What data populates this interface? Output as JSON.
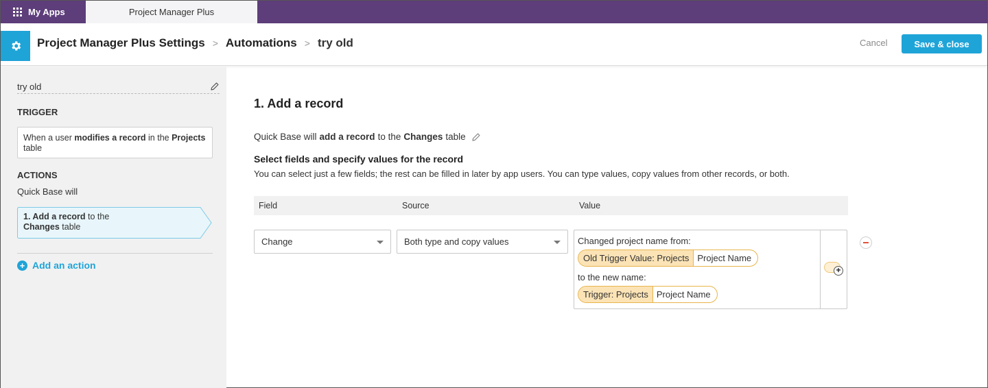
{
  "topbar": {
    "my_apps_label": "My Apps",
    "app_tab_label": "Project Manager Plus",
    "bg_color": "#5d3d7a"
  },
  "header": {
    "breadcrumb": [
      "Project Manager Plus Settings",
      "Automations",
      "try old"
    ],
    "cancel_label": "Cancel",
    "save_label": "Save & close",
    "accent_color": "#1fa4d8"
  },
  "sidebar": {
    "automation_name": "try old",
    "trigger_heading": "TRIGGER",
    "trigger": {
      "t1": "When a user ",
      "b1": "modifies a record",
      "t2": " in the ",
      "b2": "Projects",
      "t3": " table"
    },
    "actions_heading": "ACTIONS",
    "actions_intro": "Quick Base will",
    "action": {
      "b1": "1. Add a record",
      "t1": " to the",
      "b2": "Changes",
      "t2": " table"
    },
    "add_action_label": "Add an action"
  },
  "main": {
    "title": "1. Add a record",
    "desc": {
      "t1": "Quick Base will",
      "b1": "add a record",
      "t2": "to the",
      "b2": "Changes",
      "t3": "table"
    },
    "sub_heading": "Select fields and specify values for the record",
    "sub_text": "You can select just a few fields; the rest can be filled in later by app users. You can type values, copy values from other records, or both.",
    "table_headers": {
      "field": "Field",
      "source": "Source",
      "value": "Value"
    },
    "row": {
      "field": "Change",
      "source": "Both type and copy values",
      "value_line1": "Changed project name from:",
      "pill1": {
        "table": "Old Trigger Value: Projects",
        "field": "Project Name"
      },
      "value_line2": "to the new name:",
      "pill2": {
        "table": "Trigger: Projects",
        "field": "Project Name"
      }
    }
  }
}
